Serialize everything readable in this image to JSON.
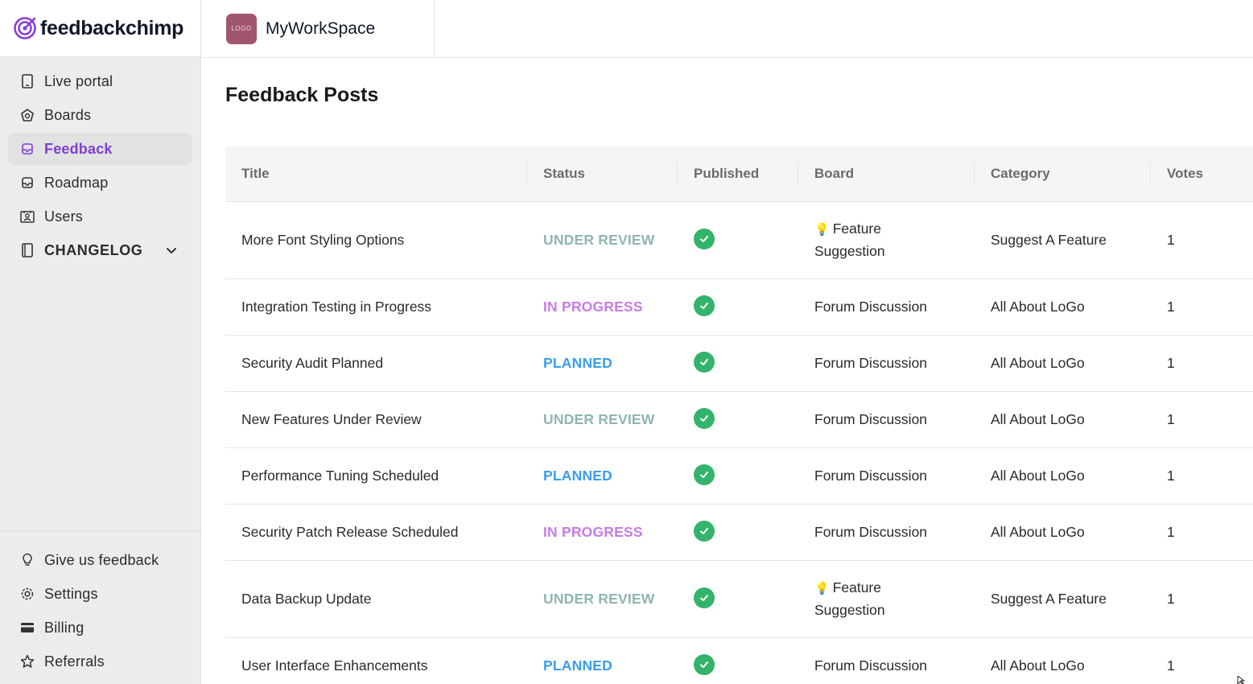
{
  "brand": {
    "name": "feedbackchimp",
    "accent": "#7e3fd1"
  },
  "workspace": {
    "name": "MyWorkSpace",
    "logo_text": "LOGO"
  },
  "sidebar": {
    "items": [
      {
        "label": "Live portal",
        "icon": "tablet-icon"
      },
      {
        "label": "Boards",
        "icon": "boards-icon"
      },
      {
        "label": "Feedback",
        "icon": "inbox-icon",
        "active": true
      },
      {
        "label": "Roadmap",
        "icon": "roadmap-icon"
      },
      {
        "label": "Users",
        "icon": "users-icon"
      },
      {
        "label": "CHANGELOG",
        "icon": "book-icon",
        "expandable": true
      }
    ],
    "bottom_items": [
      {
        "label": "Give us feedback",
        "icon": "lightbulb-icon"
      },
      {
        "label": "Settings",
        "icon": "gear-icon"
      },
      {
        "label": "Billing",
        "icon": "card-icon"
      },
      {
        "label": "Referrals",
        "icon": "star-icon"
      }
    ]
  },
  "main": {
    "title": "Feedback Posts",
    "table": {
      "columns": [
        "Title",
        "Status",
        "Published",
        "Board",
        "Category",
        "Votes"
      ],
      "rows": [
        {
          "title": "More Font Styling Options",
          "status": "UNDER REVIEW",
          "published": true,
          "board_icon": "💡",
          "board_line1": "Feature",
          "board_line2": "Suggestion",
          "category": "Suggest A Feature",
          "votes": "1"
        },
        {
          "title": "Integration Testing in Progress",
          "status": "IN PROGRESS",
          "published": true,
          "board_line1": "Forum Discussion",
          "category": "All About LoGo",
          "votes": "1"
        },
        {
          "title": "Security Audit Planned",
          "status": "PLANNED",
          "published": true,
          "board_line1": "Forum Discussion",
          "category": "All About LoGo",
          "votes": "1"
        },
        {
          "title": "New Features Under Review",
          "status": "UNDER REVIEW",
          "published": true,
          "board_line1": "Forum Discussion",
          "category": "All About LoGo",
          "votes": "1"
        },
        {
          "title": "Performance Tuning Scheduled",
          "status": "PLANNED",
          "published": true,
          "board_line1": "Forum Discussion",
          "category": "All About LoGo",
          "votes": "1"
        },
        {
          "title": "Security Patch Release Scheduled",
          "status": "IN PROGRESS",
          "published": true,
          "board_line1": "Forum Discussion",
          "category": "All About LoGo",
          "votes": "1"
        },
        {
          "title": "Data Backup Update",
          "status": "UNDER REVIEW",
          "published": true,
          "board_icon": "💡",
          "board_line1": "Feature",
          "board_line2": "Suggestion",
          "category": "Suggest A Feature",
          "votes": "1"
        },
        {
          "title": "User Interface Enhancements",
          "status": "PLANNED",
          "published": true,
          "board_line1": "Forum Discussion",
          "category": "All About LoGo",
          "votes": "1"
        }
      ]
    },
    "status_colors": {
      "UNDER REVIEW": "#8fb5b3",
      "IN PROGRESS": "#c57ce6",
      "PLANNED": "#3b9ee8"
    },
    "published_color": "#34b36a"
  }
}
